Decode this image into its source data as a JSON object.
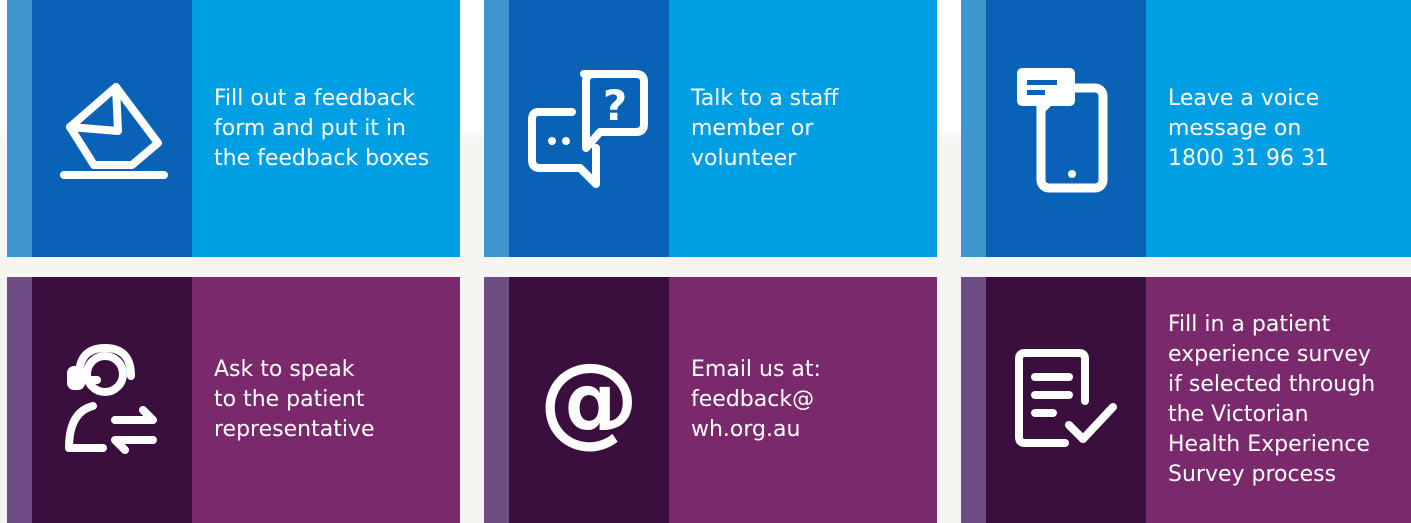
{
  "colors": {
    "blue_stripe": "#3f96cc",
    "blue_icon_panel": "#0a62b6",
    "blue_text_panel": "#009fe3",
    "purple_stripe": "#6e4d85",
    "purple_icon_panel": "#3a0f3e",
    "purple_text_panel": "#7a2a6c",
    "icon": "#ffffff"
  },
  "cards": [
    {
      "icon": "envelope-into-box-icon",
      "text": "Fill out a feedback\nform and put it in\nthe feedback boxes"
    },
    {
      "icon": "speech-bubbles-question-icon",
      "text": "Talk to a staff\nmember or\nvolunteer"
    },
    {
      "icon": "mobile-phone-message-icon",
      "text": "Leave a voice\nmessage on\n1800 31 96 31"
    },
    {
      "icon": "headset-person-icon",
      "text": "Ask to speak\nto the patient\nrepresentative"
    },
    {
      "icon": "at-sign-icon",
      "glyph": "@",
      "text": "Email us at:\nfeedback@\nwh.org.au"
    },
    {
      "icon": "checklist-document-icon",
      "text": "Fill in a patient\nexperience survey\nif selected through\nthe Victorian\nHealth Experience\nSurvey process"
    }
  ]
}
